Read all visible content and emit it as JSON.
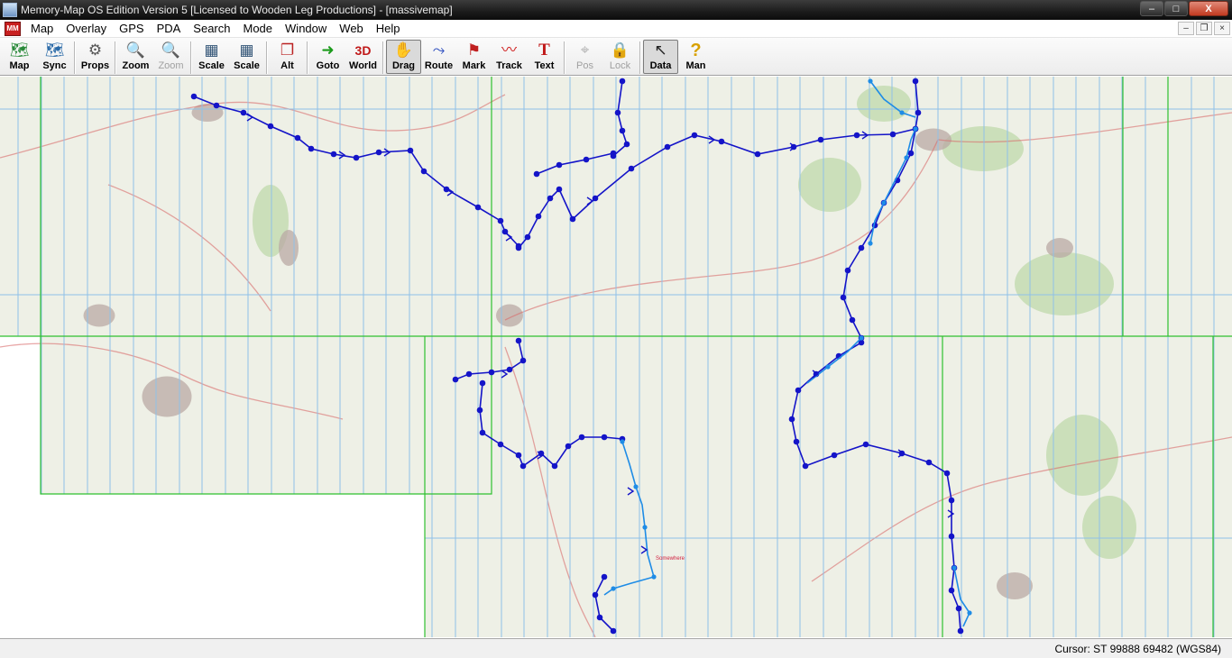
{
  "window": {
    "title": "Memory-Map OS Edition Version 5 [Licensed to Wooden Leg Productions] - [massivemap]",
    "controls": {
      "minimize": "–",
      "maximize": "□",
      "close": "X"
    }
  },
  "menubar": {
    "logo_text": "MM",
    "items": [
      "Map",
      "Overlay",
      "GPS",
      "PDA",
      "Search",
      "Mode",
      "Window",
      "Web",
      "Help"
    ],
    "mdi": {
      "minimize": "–",
      "restore": "❐",
      "close": "×"
    }
  },
  "toolbar": {
    "buttons": [
      {
        "label": "Map",
        "icon": "map-icon",
        "glyph": "🗺",
        "state": "normal"
      },
      {
        "label": "Sync",
        "icon": "sync-icon",
        "glyph": "🗺",
        "state": "normal"
      },
      {
        "label": "Props",
        "icon": "properties-icon",
        "glyph": "⚙",
        "state": "normal"
      },
      {
        "label": "Zoom",
        "icon": "zoom-in-icon",
        "glyph": "🔍",
        "state": "normal"
      },
      {
        "label": "Zoom",
        "icon": "zoom-out-icon",
        "glyph": "🔍",
        "state": "disabled"
      },
      {
        "label": "Scale",
        "icon": "scale-up-icon",
        "glyph": "▦",
        "state": "normal"
      },
      {
        "label": "Scale",
        "icon": "scale-down-icon",
        "glyph": "▦",
        "state": "normal"
      },
      {
        "label": "Alt",
        "icon": "alternate-map-icon",
        "glyph": "❐",
        "state": "normal"
      },
      {
        "label": "Goto",
        "icon": "goto-arrow-icon",
        "glyph": "➜",
        "state": "normal"
      },
      {
        "label": "World",
        "icon": "3d-world-icon",
        "glyph": "3D",
        "state": "normal"
      },
      {
        "label": "Drag",
        "icon": "hand-icon",
        "glyph": "✋",
        "state": "pressed"
      },
      {
        "label": "Route",
        "icon": "route-icon",
        "glyph": "⤳",
        "state": "normal"
      },
      {
        "label": "Mark",
        "icon": "mark-flag-icon",
        "glyph": "⚑",
        "state": "normal"
      },
      {
        "label": "Track",
        "icon": "track-icon",
        "glyph": "〰",
        "state": "normal"
      },
      {
        "label": "Text",
        "icon": "text-icon",
        "glyph": "T",
        "state": "normal"
      },
      {
        "label": "Pos",
        "icon": "position-icon",
        "glyph": "⌖",
        "state": "disabled"
      },
      {
        "label": "Lock",
        "icon": "lock-icon",
        "glyph": "🔒",
        "state": "disabled"
      },
      {
        "label": "Data",
        "icon": "data-cursor-icon",
        "glyph": "↖",
        "state": "pressed"
      },
      {
        "label": "Man",
        "icon": "manual-help-icon",
        "glyph": "?",
        "state": "normal"
      }
    ]
  },
  "map": {
    "colors": {
      "paper": "#eef0e6",
      "grid": "#8fc0e8",
      "tile_border": "#2fc02f",
      "track_dark": "#1414c8",
      "track_light": "#1e8ce6",
      "town": "#b9a9a4",
      "wood": "#c4dcb2",
      "road": "#d86a6a"
    },
    "red_label": "Somewhere"
  },
  "status": {
    "cursor": "Cursor: ST 99888 69482 (WGS84)"
  }
}
